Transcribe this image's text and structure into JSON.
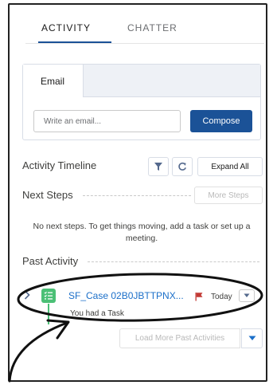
{
  "tabs": [
    {
      "label": "ACTIVITY",
      "active": true
    },
    {
      "label": "CHATTER",
      "active": false
    }
  ],
  "composer": {
    "tab_label": "Email",
    "placeholder": "Write an email...",
    "compose_label": "Compose"
  },
  "timeline": {
    "title": "Activity Timeline",
    "expand_label": "Expand All"
  },
  "next_steps": {
    "title": "Next Steps",
    "more_label": "More Steps",
    "empty_text": "No next steps. To get things moving, add a task or set up a meeting."
  },
  "past_activity": {
    "title": "Past Activity",
    "items": [
      {
        "subject": "SF_Case 02B0JBTTPNX...",
        "date": "Today",
        "summary": "You had a Task"
      }
    ],
    "load_more_label": "Load More Past Activities"
  },
  "icons": {
    "filter": "filter-icon",
    "refresh": "refresh-icon",
    "chevron": "chevron-right-icon",
    "task": "task-icon",
    "flag": "flag-icon",
    "dropdown": "chevron-down-icon"
  },
  "colors": {
    "brand": "#1b5297",
    "link": "#1b6fc9",
    "task_green": "#4bc076",
    "flag_red": "#c23934"
  }
}
